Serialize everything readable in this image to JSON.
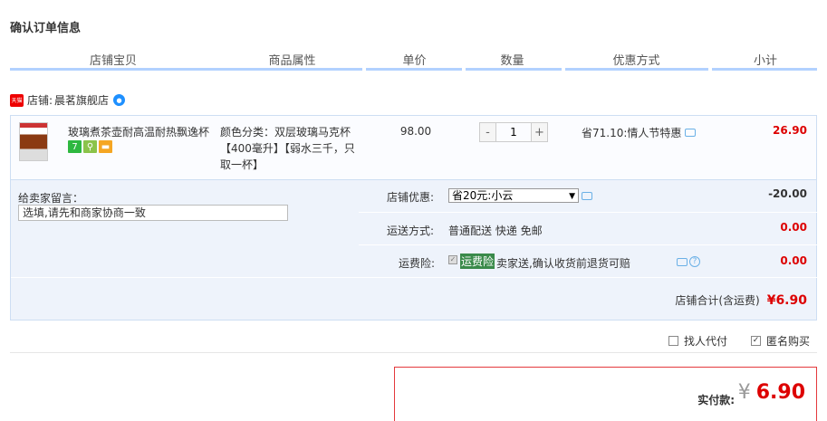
{
  "page_title": "确认订单信息",
  "columns": [
    "店铺宝贝",
    "商品属性",
    "单价",
    "数量",
    "优惠方式",
    "小计"
  ],
  "shop": {
    "prefix": "店铺:",
    "name": "晨茗旗舰店",
    "badge": "天猫"
  },
  "item": {
    "title": "玻璃煮茶壶耐高温耐热飘逸杯",
    "attr_line1": "颜色分类：双层玻璃马克杯",
    "attr_line2": "【400毫升】【弱水三千，只取一杯】",
    "price": "98.00",
    "qty": "1",
    "qty_minus": "-",
    "qty_plus": "+",
    "promo": "省71.10:情人节特惠",
    "subtotal": "26.90",
    "badges": [
      "7",
      "",
      ""
    ]
  },
  "options": {
    "message_label": "给卖家留言：",
    "message_placeholder": "选填,请先和商家协商一致",
    "shop_discount_label": "店铺优惠:",
    "shop_discount_value": "省20元:小云",
    "shop_discount_amount": "-20.00",
    "shipping_label": "运送方式:",
    "shipping_value": "普通配送 快递 免邮",
    "shipping_amount": "0.00",
    "insurance_label": "运费险:",
    "insurance_tag": "运费险",
    "insurance_text": "卖家送,确认收货前退货可赔",
    "insurance_amount": "0.00",
    "shop_total_label": "店铺合计(含运费)",
    "shop_total_value": "¥6.90"
  },
  "checks": {
    "proxy_pay": "找人代付",
    "anonymous": "匿名购买"
  },
  "payment": {
    "label": "实付款:",
    "yen": "¥",
    "value": "6.90"
  },
  "colors": {
    "accent_red": "#dd0000",
    "header_bar": "#b2d1ff",
    "opts_bg": "#eef3fb"
  }
}
